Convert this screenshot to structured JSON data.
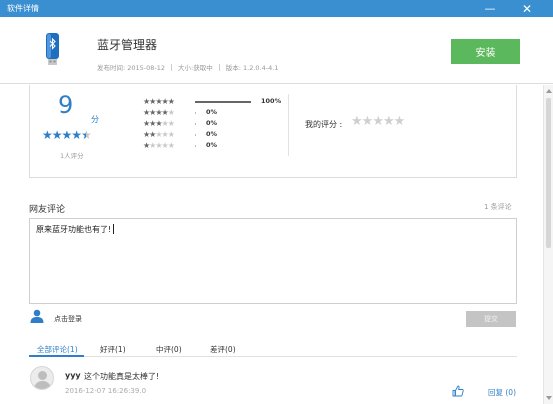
{
  "window": {
    "title": "软件详情",
    "minimize_glyph": "—",
    "close_glyph": "✕"
  },
  "app": {
    "name": "蓝牙管理器",
    "release_date": "发布时间: 2015-08-12",
    "size": "大小:获取中",
    "version": "版本: 1.2.0.4-4.1",
    "install_label": "安装",
    "icon": "bluetooth-app-icon"
  },
  "rating": {
    "score": "9",
    "score_unit": "分",
    "average_stars": 4.5,
    "rater_count": "1人评分",
    "distribution": [
      {
        "stars": 5,
        "percent": "100%",
        "fraction": 1.0
      },
      {
        "stars": 4,
        "percent": "0%",
        "fraction": 0
      },
      {
        "stars": 3,
        "percent": "0%",
        "fraction": 0
      },
      {
        "stars": 2,
        "percent": "0%",
        "fraction": 0
      },
      {
        "stars": 1,
        "percent": "0%",
        "fraction": 0
      }
    ],
    "my_rating_label": "我的评分 :",
    "my_rating_value": 0
  },
  "comments": {
    "section_title": "网友评论",
    "count_label": "1 条评论",
    "draft_text": "原来蓝牙功能也有了!",
    "login_label": "点击登录",
    "submit_label": "提交",
    "tabs": [
      {
        "label": "全部评论(1)",
        "active": true
      },
      {
        "label": "好评(1)",
        "active": false
      },
      {
        "label": "中评(0)",
        "active": false
      },
      {
        "label": "差评(0)",
        "active": false
      }
    ],
    "items": [
      {
        "user": "yyy",
        "text": "这个功能真是太棒了!",
        "time": "2016-12-07 16:26:39.0",
        "reply_label": "回复 (0)"
      }
    ]
  },
  "colors": {
    "title_bar": "#3a8fd0",
    "accent": "#2e7fc7",
    "install_button": "#5cb85c",
    "submit_button_disabled": "#c4c4c4"
  }
}
